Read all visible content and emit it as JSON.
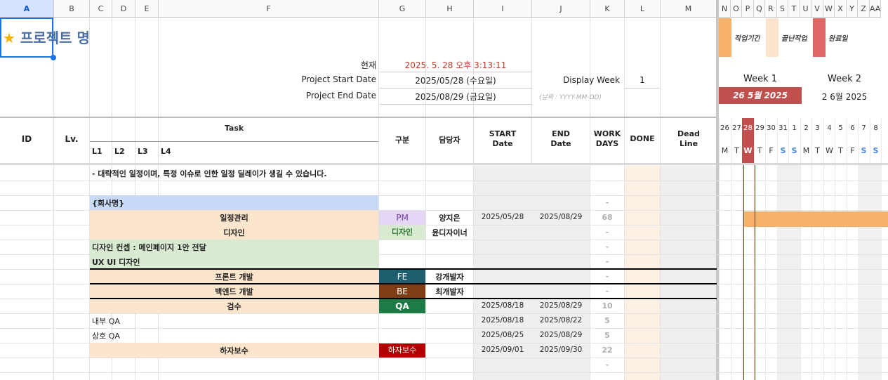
{
  "columns": [
    "A",
    "B",
    "C",
    "D",
    "E",
    "F",
    "G",
    "H",
    "I",
    "J",
    "K",
    "L",
    "M",
    "N",
    "O",
    "P",
    "Q",
    "R",
    "S",
    "T",
    "U",
    "V",
    "W",
    "X",
    "Y",
    "Z",
    "AA"
  ],
  "title": "프로젝트 명",
  "title_icon": "star-icon",
  "info": {
    "now_label": "현재",
    "now_value": "2025. 5. 28 오후 3:13:11",
    "start_label": "Project Start Date",
    "start_value": "2025/05/28 (수요일)",
    "end_label": "Project End Date",
    "end_value": "2025/08/29 (금요일)",
    "display_week_label": "Display Week",
    "display_week_value": "1",
    "date_hint": "(날짜 : YYYY-MM-DD)"
  },
  "legend": [
    {
      "label": "작업기간",
      "color": "#f6b26b"
    },
    {
      "label": "끝난작업",
      "color": "#fce5cd"
    },
    {
      "label": "완료일",
      "color": "#e06666"
    }
  ],
  "weeks": [
    {
      "label": "Week 1",
      "date": "26 5월 2025"
    },
    {
      "label": "Week 2",
      "date": "2 6월 2025"
    }
  ],
  "days": [
    "26",
    "27",
    "28",
    "29",
    "30",
    "31",
    "1",
    "2",
    "3",
    "4",
    "5",
    "6",
    "7",
    "8"
  ],
  "weekdays": [
    "M",
    "T",
    "W",
    "T",
    "F",
    "S",
    "S",
    "M",
    "T",
    "W",
    "T",
    "F",
    "S",
    "S"
  ],
  "headers": {
    "id": "ID",
    "lv": "Lv.",
    "task": "Task",
    "l1": "L1",
    "l2": "L2",
    "l3": "L3",
    "l4": "L4",
    "category": "구분",
    "owner": "담당자",
    "start": "START\nDate",
    "end": "END\nDate",
    "workdays": "WORK\nDAYS",
    "done": "DONE",
    "deadline": "Dead\nLine"
  },
  "colors": {
    "accent_red": "#c0504d",
    "pm": "#e4d7f5",
    "design": "#d9ead3",
    "fe": "#1f5e6e",
    "be": "#7f3d13",
    "qa": "#1e7b45",
    "warranty": "#b00000",
    "bar": "#f6b26b"
  },
  "rows": [
    {
      "text": "- 대략적인 일정이며, 특정 이슈로 인한 일정 딜레이가 생길 수 있습니다."
    },
    {
      "text": ""
    },
    {
      "text": "{회사명}",
      "wd": "-"
    },
    {
      "text": "일정관리",
      "cat": "PM",
      "owner": "양지은",
      "start": "2025/05/28",
      "end": "2025/08/29",
      "wd": "68"
    },
    {
      "text": "디자인",
      "cat": "디자인",
      "owner": "윤디자이너",
      "wd": "-"
    },
    {
      "text": "디자인 컨셉 : 메인페이지 1안 전달",
      "wd": "-"
    },
    {
      "text": "UX UI 디자인",
      "wd": "-"
    },
    {
      "text": "프론트 개발",
      "cat": "FE",
      "owner": "강개발자",
      "wd": "-"
    },
    {
      "text": "백엔드 개발",
      "cat": "BE",
      "owner": "최개발자",
      "wd": "-"
    },
    {
      "text": "검수",
      "cat": "QA",
      "start": "2025/08/18",
      "end": "2025/08/29",
      "wd": "10"
    },
    {
      "text": "내부 QA",
      "start": "2025/08/18",
      "end": "2025/08/22",
      "wd": "5"
    },
    {
      "text": "상호 QA",
      "start": "2025/08/25",
      "end": "2025/08/29",
      "wd": "5"
    },
    {
      "text": "하자보수",
      "cat": "하자보수",
      "start": "2025/09/01",
      "end": "2025/09/30",
      "wd": "22"
    },
    {
      "text": "",
      "wd": "-"
    }
  ]
}
